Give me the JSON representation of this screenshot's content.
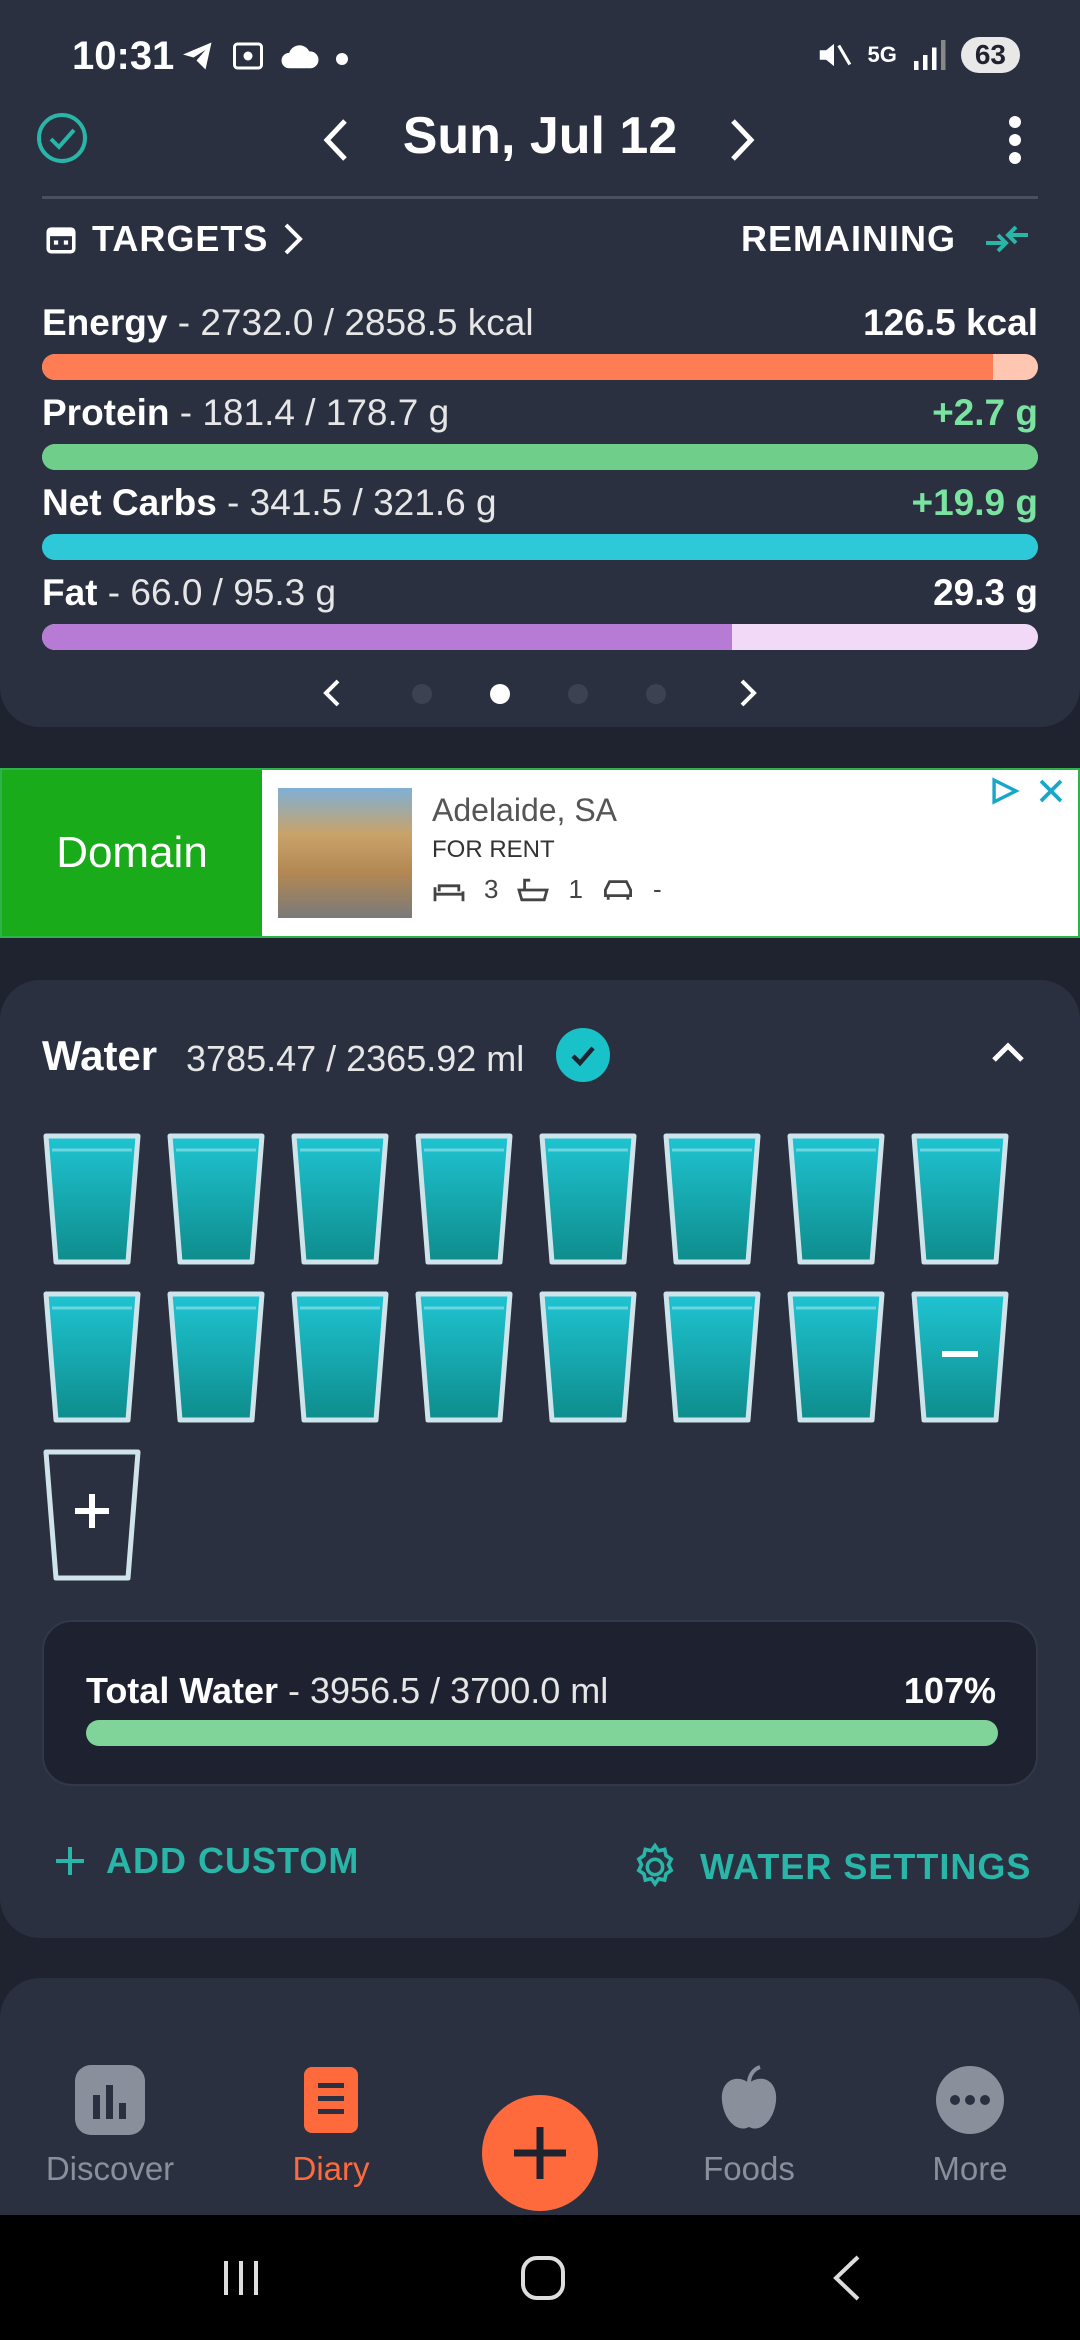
{
  "status_bar": {
    "time": "10:31",
    "network": "5G",
    "battery": "63"
  },
  "header": {
    "date": "Sun, Jul 12"
  },
  "targets": {
    "label": "TARGETS",
    "remaining_label": "REMAINING",
    "rows": [
      {
        "name": "Energy",
        "detail": " - 2732.0 / 2858.5 kcal",
        "remaining": "126.5 kcal",
        "progress": 0.955,
        "color": "#ff7d55",
        "track": "#ffc7b1",
        "value_color": "#ffffff"
      },
      {
        "name": "Protein",
        "detail": " - 181.4 / 178.7 g",
        "remaining": "+2.7 g",
        "progress": 1.0,
        "color": "#6fcf8a",
        "track": "#6fcf8a",
        "value_color": "#7be3a0"
      },
      {
        "name": "Net Carbs",
        "detail": " - 341.5 / 321.6 g",
        "remaining": "+19.9 g",
        "progress": 1.0,
        "color": "#2ec9d8",
        "track": "#2ec9d8",
        "value_color": "#7be3a0"
      },
      {
        "name": "Fat",
        "detail": " - 66.0 / 95.3 g",
        "remaining": "29.3 g",
        "progress": 0.693,
        "color": "#b77bd6",
        "track": "#f2d9f7",
        "value_color": "#ffffff"
      }
    ],
    "pager": {
      "pages": 4,
      "active": 1
    }
  },
  "ad": {
    "brand": "Domain",
    "title": "Adelaide, SA",
    "subtitle": "FOR RENT",
    "beds": "3",
    "baths": "1",
    "cars": "-"
  },
  "water": {
    "title": "Water",
    "amount": "3785.47 / 2365.92 ml",
    "glasses_filled": 16,
    "total": {
      "label": "Total Water",
      "detail": " - 3956.5 / 3700.0 ml",
      "percent": "107%",
      "progress": 1.0
    },
    "add_custom": "ADD CUSTOM",
    "settings": "WATER SETTINGS"
  },
  "bottom_nav": {
    "items": [
      {
        "label": "Discover",
        "icon": "chart-icon",
        "active": false
      },
      {
        "label": "Diary",
        "icon": "diary-icon",
        "active": true
      },
      {
        "label": "Foods",
        "icon": "apple-icon",
        "active": false
      },
      {
        "label": "More",
        "icon": "more-icon",
        "active": false
      }
    ]
  },
  "colors": {
    "accent": "#ff6a3d",
    "teal": "#29b5a8",
    "card": "#2a3040",
    "background": "#1f2330"
  }
}
